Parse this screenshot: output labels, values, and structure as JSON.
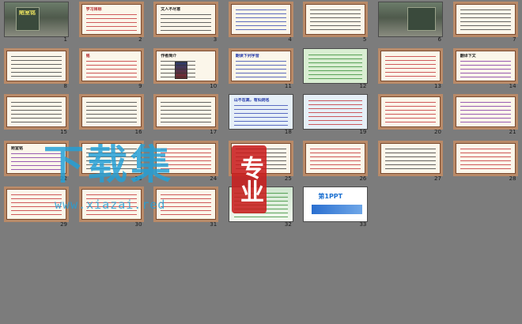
{
  "slides": [
    {
      "number": "1",
      "style": "photo",
      "title": "陋室铭",
      "title_color": "#e8e060"
    },
    {
      "number": "2",
      "style": "border",
      "title": "学习目标",
      "lines": "red"
    },
    {
      "number": "3",
      "style": "border",
      "title": "文人不尽意",
      "lines": "dark"
    },
    {
      "number": "4",
      "style": "border",
      "title": "",
      "lines": "blue"
    },
    {
      "number": "5",
      "style": "border",
      "title": "",
      "lines": "dark"
    },
    {
      "number": "6",
      "style": "photo",
      "title": "",
      "title_color": "#ffffff"
    },
    {
      "number": "7",
      "style": "border",
      "title": "",
      "lines": "dark"
    },
    {
      "number": "8",
      "style": "border",
      "title": "",
      "lines": "dark"
    },
    {
      "number": "9",
      "style": "border",
      "title": "铭",
      "lines": "red"
    },
    {
      "number": "10",
      "style": "portrait",
      "title": "作者简介",
      "lines": "dark"
    },
    {
      "number": "11",
      "style": "border",
      "title": "朗读下列字音",
      "lines": "blue"
    },
    {
      "number": "12",
      "style": "green",
      "title": "",
      "lines": "green"
    },
    {
      "number": "13",
      "style": "border",
      "title": "",
      "lines": "red"
    },
    {
      "number": "14",
      "style": "border",
      "title": "翻译下文",
      "lines": "purple"
    },
    {
      "number": "15",
      "style": "border",
      "title": "",
      "lines": "dark"
    },
    {
      "number": "16",
      "style": "border",
      "title": "",
      "lines": "dark"
    },
    {
      "number": "17",
      "style": "border",
      "title": "",
      "lines": "dark"
    },
    {
      "number": "18",
      "style": "blue",
      "title": "山不在高，有仙则名",
      "lines": "blue"
    },
    {
      "number": "19",
      "style": "blue",
      "title": "",
      "lines": "red"
    },
    {
      "number": "20",
      "style": "border",
      "title": "",
      "lines": "red"
    },
    {
      "number": "21",
      "style": "border",
      "title": "",
      "lines": "purple"
    },
    {
      "number": "22",
      "style": "border",
      "title": "陋室铭",
      "lines": "purple"
    },
    {
      "number": "23",
      "style": "border",
      "title": "",
      "lines": "dark"
    },
    {
      "number": "24",
      "style": "border",
      "title": "",
      "lines": "red"
    },
    {
      "number": "25",
      "style": "border",
      "title": "",
      "lines": "dark"
    },
    {
      "number": "26",
      "style": "border",
      "title": "",
      "lines": "red"
    },
    {
      "number": "27",
      "style": "border",
      "title": "",
      "lines": "dark"
    },
    {
      "number": "28",
      "style": "border",
      "title": "",
      "lines": "red"
    },
    {
      "number": "29",
      "style": "border",
      "title": "",
      "lines": "red"
    },
    {
      "number": "30",
      "style": "border",
      "title": "",
      "lines": "red"
    },
    {
      "number": "31",
      "style": "border",
      "title": "",
      "lines": "red"
    },
    {
      "number": "32",
      "style": "gate",
      "title": "",
      "lines": "green"
    },
    {
      "number": "33",
      "style": "ppt",
      "title": "第1PPT",
      "lines": "blue"
    }
  ],
  "watermark": {
    "main": "下载集",
    "badge": "专业",
    "url": "www.xiazai.red"
  }
}
